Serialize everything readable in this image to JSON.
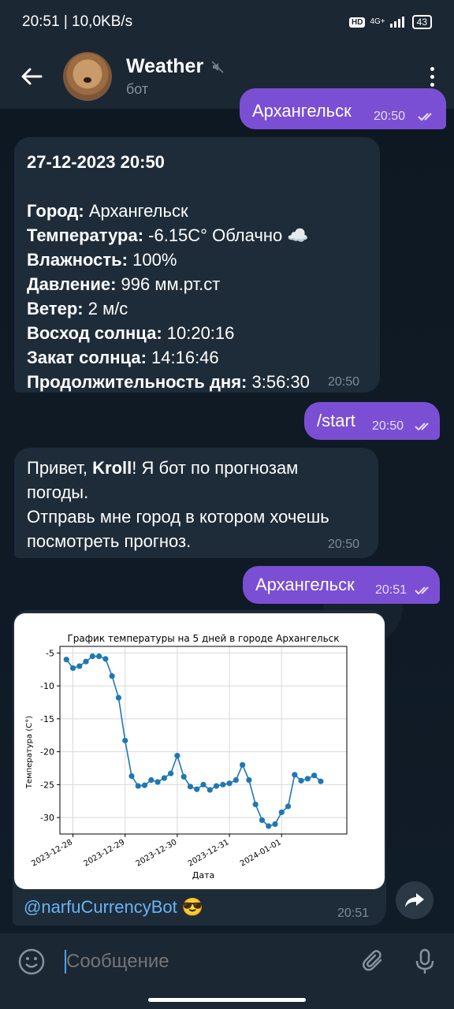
{
  "status_bar": {
    "time_speed": "20:51 | 10,0KB/s",
    "hd": "HD",
    "network": "4G+",
    "battery": "43"
  },
  "header": {
    "title": "Weather",
    "subtitle": "бот"
  },
  "messages": {
    "top_out": {
      "text": "Архангельск",
      "time": "20:50"
    },
    "weather": {
      "date": "27-12-2023 20:50",
      "city_label": "Город:",
      "city_value": " Архангельск",
      "temp_label": "Температура:",
      "temp_value": " -6.15C° Облачно ☁️",
      "humidity_label": "Влажность:",
      "humidity_value": " 100%",
      "pressure_label": "Давление:",
      "pressure_value": " 996 мм.рт.ст",
      "wind_label": "Ветер:",
      "wind_value": " 2 м/с",
      "sunrise_label": "Восход солнца:",
      "sunrise_value": " 10:20:16",
      "sunset_label": "Закат солнца:",
      "sunset_value": " 14:16:46",
      "daylen_label": "Продолжительность дня:",
      "daylen_value": " 3:56:30",
      "time": "20:50"
    },
    "start": {
      "text": "/start",
      "time": "20:50"
    },
    "greeting": {
      "part1": "Привет, ",
      "name": "Kroll",
      "part2": "! Я бот по прогнозам",
      "line2": "погоды.",
      "line3": "Отправь мне город в котором хочешь",
      "line4": "посмотреть прогноз.",
      "time": "20:50"
    },
    "city_out": {
      "text": "Архангельск",
      "time": "20:51"
    },
    "chart_msg": {
      "caption": "@narfuCurrencyBot 😎",
      "time": "20:51"
    }
  },
  "input": {
    "placeholder": "Сообщение"
  },
  "colors": {
    "outgoing": "#7a4fd3",
    "incoming": "#1e2c3a",
    "chart_line": "#1f77b4"
  },
  "chart_data": {
    "type": "line",
    "title": "График температуры на 5 дней в городе Архангельск",
    "xlabel": "Дата",
    "ylabel": "Температура (C°)",
    "x_tick_labels": [
      "2023-12-28",
      "2023-12-29",
      "2023-12-30",
      "2023-12-31",
      "2024-01-01"
    ],
    "y_ticks": [
      -5,
      -10,
      -15,
      -20,
      -25,
      -30
    ],
    "ylim": [
      -32.5,
      -4
    ],
    "grid": true,
    "x": [
      "2023-12-27 21:00",
      "2023-12-28 00:00",
      "2023-12-28 03:00",
      "2023-12-28 06:00",
      "2023-12-28 09:00",
      "2023-12-28 12:00",
      "2023-12-28 15:00",
      "2023-12-28 18:00",
      "2023-12-28 21:00",
      "2023-12-29 00:00",
      "2023-12-29 03:00",
      "2023-12-29 06:00",
      "2023-12-29 09:00",
      "2023-12-29 12:00",
      "2023-12-29 15:00",
      "2023-12-29 18:00",
      "2023-12-29 21:00",
      "2023-12-30 00:00",
      "2023-12-30 03:00",
      "2023-12-30 06:00",
      "2023-12-30 09:00",
      "2023-12-30 12:00",
      "2023-12-30 15:00",
      "2023-12-30 18:00",
      "2023-12-30 21:00",
      "2023-12-31 00:00",
      "2023-12-31 03:00",
      "2023-12-31 06:00",
      "2023-12-31 09:00",
      "2023-12-31 12:00",
      "2023-12-31 15:00",
      "2023-12-31 18:00",
      "2023-12-31 21:00",
      "2024-01-01 00:00",
      "2024-01-01 03:00",
      "2024-01-01 06:00",
      "2024-01-01 09:00",
      "2024-01-01 12:00",
      "2024-01-01 15:00",
      "2024-01-01 18:00"
    ],
    "values": [
      -6.0,
      -7.3,
      -7.0,
      -6.3,
      -5.5,
      -5.5,
      -5.9,
      -8.5,
      -11.8,
      -18.3,
      -23.7,
      -25.2,
      -25.1,
      -24.3,
      -24.6,
      -24.0,
      -23.3,
      -20.6,
      -23.8,
      -25.3,
      -25.7,
      -25.0,
      -25.8,
      -25.2,
      -25.0,
      -24.8,
      -24.3,
      -22.0,
      -24.3,
      -28.0,
      -30.4,
      -31.3,
      -31.0,
      -29.2,
      -28.3,
      -23.5,
      -24.4,
      -24.1,
      -23.6,
      -24.5
    ]
  }
}
